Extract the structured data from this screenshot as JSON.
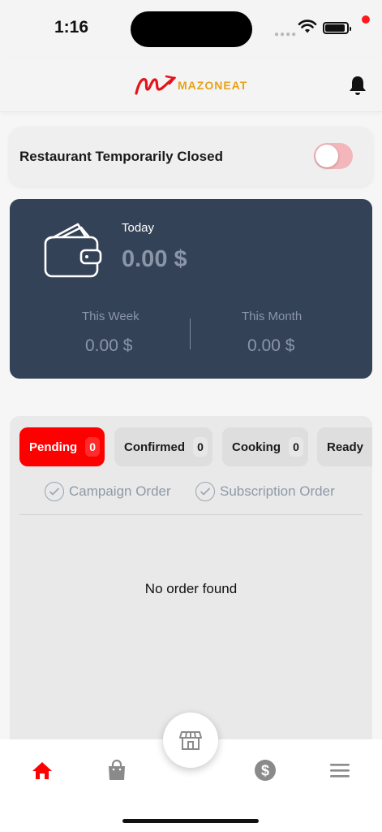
{
  "status_bar": {
    "time": "1:16"
  },
  "header": {
    "brand": "MAZONEAT"
  },
  "closed_toggle": {
    "label": "Restaurant Temporarily Closed",
    "on": false
  },
  "earnings": {
    "today_label": "Today",
    "today_amount": "0.00 $",
    "week_label": "This Week",
    "week_amount": "0.00 $",
    "month_label": "This Month",
    "month_amount": "0.00 $"
  },
  "orders": {
    "tabs": [
      {
        "label": "Pending",
        "count": "0",
        "active": true
      },
      {
        "label": "Confirmed",
        "count": "0",
        "active": false
      },
      {
        "label": "Cooking",
        "count": "0",
        "active": false
      },
      {
        "label": "Ready",
        "active": false
      }
    ],
    "filters": [
      {
        "label": "Campaign Order"
      },
      {
        "label": "Subscription Order"
      }
    ],
    "empty_text": "No order found"
  },
  "bottom_nav": {
    "items": [
      "home-icon",
      "shopping-bag-icon",
      "store-icon",
      "dollar-icon",
      "menu-icon"
    ],
    "active": "home-icon"
  },
  "colors": {
    "accent": "#ff0000",
    "card": "#344258",
    "muted": "#8a95a8"
  }
}
